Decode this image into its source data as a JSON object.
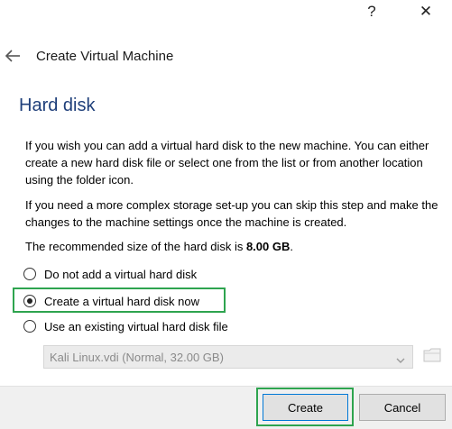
{
  "titlebar": {
    "help_label": "?",
    "close_label": "✕"
  },
  "header": {
    "title": "Create Virtual Machine"
  },
  "section": {
    "title": "Hard disk"
  },
  "content": {
    "paragraph1": "If you wish you can add a virtual hard disk to the new machine. You can either create a new hard disk file or select one from the list or from another location using the folder icon.",
    "paragraph2": "If you need a more complex storage set-up you can skip this step and make the changes to the machine settings once the machine is created.",
    "recommended_prefix": "The recommended size of the hard disk is ",
    "recommended_size": "8.00 GB",
    "recommended_suffix": "."
  },
  "options": [
    {
      "label": "Do not add a virtual hard disk",
      "checked": false
    },
    {
      "label": "Create a virtual hard disk now",
      "checked": true
    },
    {
      "label": "Use an existing virtual hard disk file",
      "checked": false
    }
  ],
  "existing_disk": {
    "selected_value": "Kali Linux.vdi (Normal, 32.00 GB)",
    "enabled": false
  },
  "buttons": {
    "create_label": "Create",
    "cancel_label": "Cancel"
  },
  "colors": {
    "section_title": "#1f3f7a",
    "highlight_border": "#2ea44f",
    "default_button_border": "#0078d7"
  }
}
